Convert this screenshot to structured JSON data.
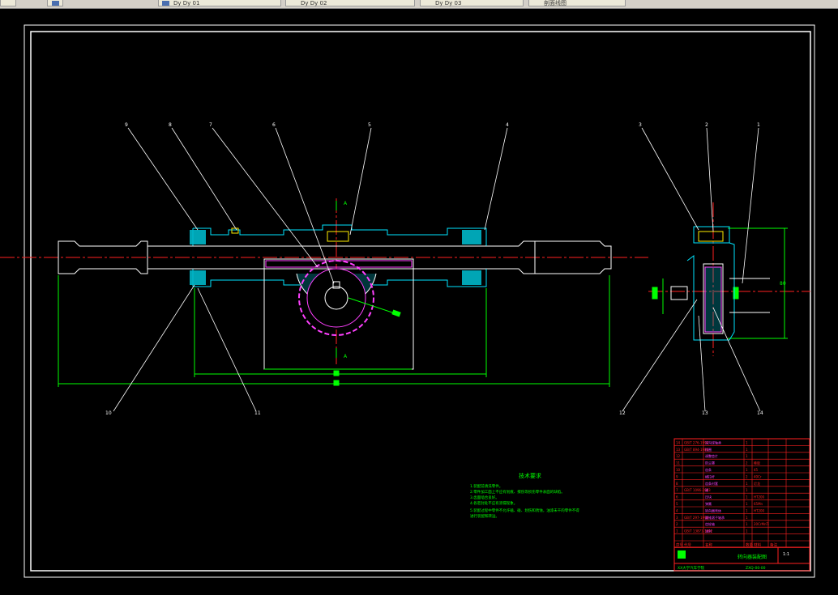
{
  "window": {
    "toolbar_tabs": [
      {
        "label": "Dy Dy 01"
      },
      {
        "label": "Dy Dy 02"
      },
      {
        "label": "Dy Dy 03"
      },
      {
        "label": "剖面线图"
      }
    ]
  },
  "drawing": {
    "balloons": [
      "9",
      "8",
      "7",
      "6",
      "5",
      "4",
      "3",
      "2",
      "1",
      "10",
      "11",
      "12",
      "13",
      "14"
    ],
    "section_mark": "A",
    "dim_label": "80",
    "tech_req": {
      "title": "技术要求",
      "lines": [
        "1.装配前清洗零件。",
        "2.零件加工面上不应有划痕、擦伤等损伤零件表面的缺陷。",
        "3.齿面啮合良好。",
        "4.各密封处不应有渗漏现象。",
        "5.装配过程中零件不允许磕、碰、划伤和锈蚀，油漆未干的零件不得",
        "  进行装配和转运。"
      ]
    },
    "title_block": {
      "drawing_title": "转向器装配图",
      "scale": "1:1",
      "school": "XX大学汽车学院",
      "drawing_no": "ZXQ-00-00",
      "header_cols": [
        "序号",
        "代号",
        "名称",
        "数量",
        "材料",
        "备注"
      ],
      "rows": [
        [
          "14",
          "GB/T 276-1994",
          "深沟球轴承",
          "1",
          "",
          ""
        ],
        [
          "13",
          "GB/T 894-1986",
          "挡圈",
          "1",
          "",
          ""
        ],
        [
          "12",
          "",
          "调整垫片",
          "1",
          "",
          ""
        ],
        [
          "11",
          "",
          "防尘罩",
          "2",
          "橡胶",
          ""
        ],
        [
          "10",
          "",
          "齿条",
          "1",
          "45",
          ""
        ],
        [
          "9",
          "",
          "横拉杆",
          "2",
          "40Cr",
          ""
        ],
        [
          "8",
          "",
          "齿条衬套",
          "1",
          "尼龙",
          ""
        ],
        [
          "7",
          "GB/T 1096-2003",
          "键",
          "1",
          "",
          ""
        ],
        [
          "6",
          "",
          "压块",
          "1",
          "HT200",
          ""
        ],
        [
          "5",
          "",
          "弹簧",
          "1",
          "65Mn",
          ""
        ],
        [
          "4",
          "",
          "转向器壳体",
          "1",
          "HT200",
          ""
        ],
        [
          "3",
          "GB/T 297-1994",
          "圆锥滚子轴承",
          "1",
          "",
          ""
        ],
        [
          "2",
          "",
          "齿轮轴",
          "1",
          "20CrMnTi",
          ""
        ],
        [
          "1",
          "GB/T 13871-1992",
          "油封",
          "1",
          "",
          ""
        ]
      ]
    }
  }
}
